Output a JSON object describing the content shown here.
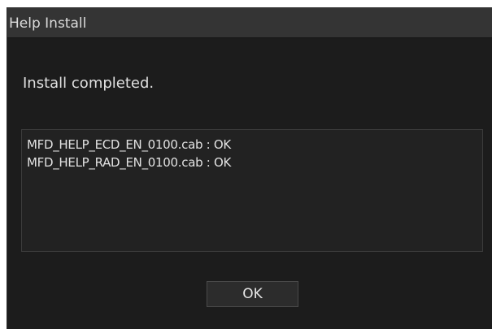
{
  "dialog": {
    "title": "Help Install",
    "message": "Install completed.",
    "results": [
      "MFD_HELP_ECD_EN_0100.cab : OK",
      "MFD_HELP_RAD_EN_0100.cab : OK"
    ],
    "ok_label": "OK"
  }
}
